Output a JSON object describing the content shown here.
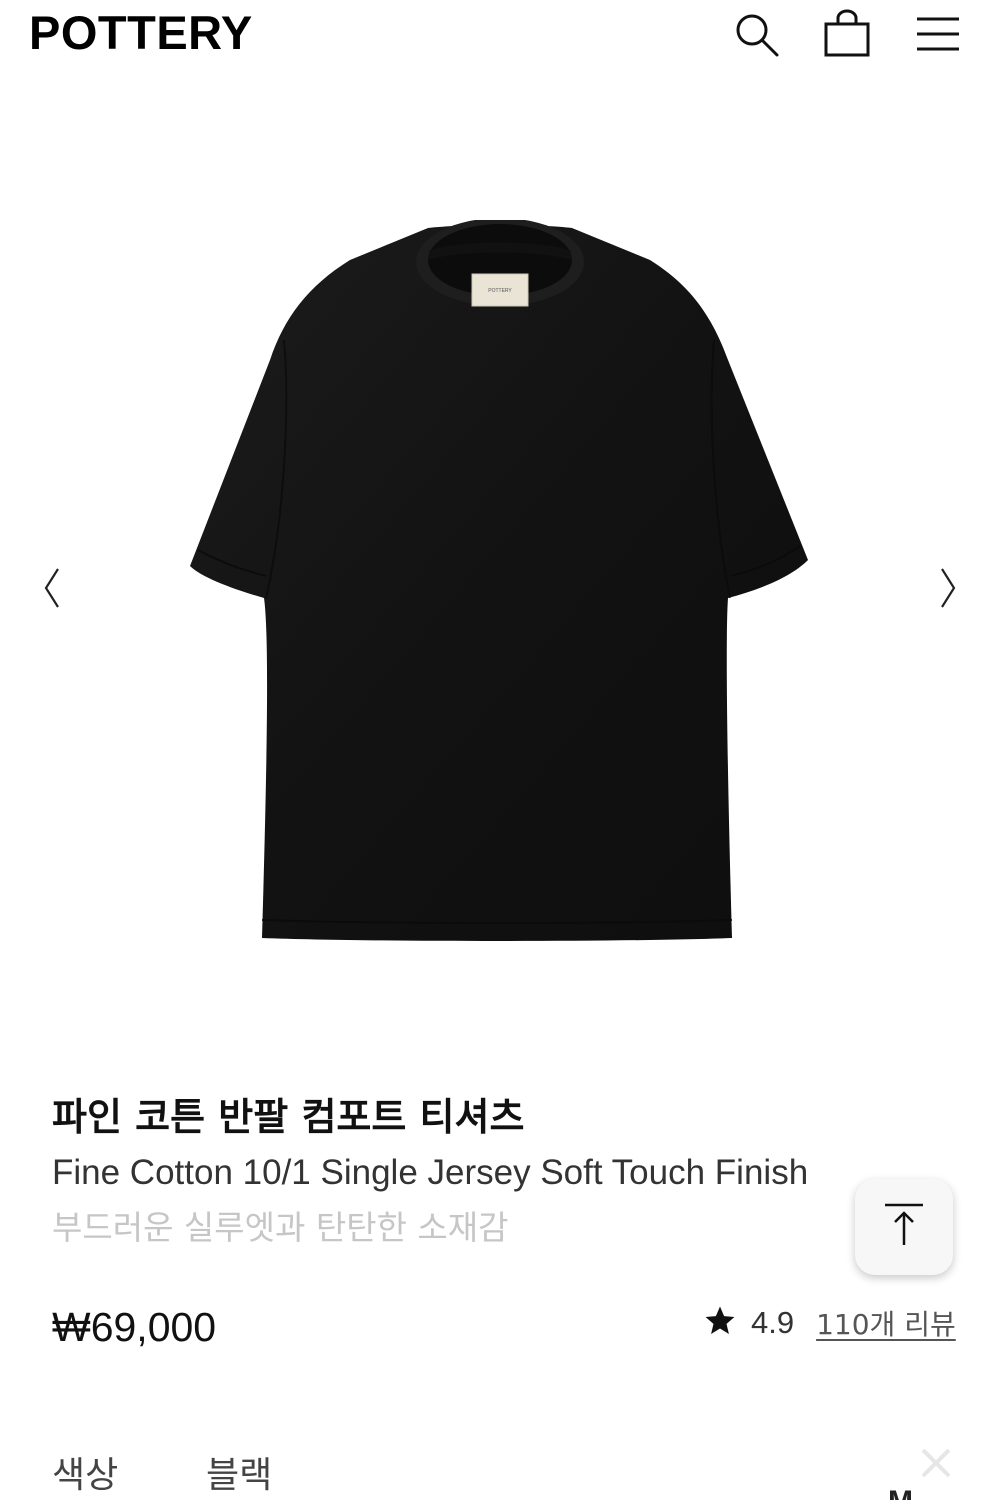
{
  "header": {
    "logo": "POTTERY",
    "icons": {
      "search": "search-icon",
      "cart": "shopping-bag-icon",
      "menu": "hamburger-menu-icon"
    }
  },
  "gallery": {
    "prev_arrow": "‹",
    "next_arrow": "›",
    "image_label_tag": "POTTERY",
    "product_color": "#141414"
  },
  "product": {
    "title_ko": "파인 코튼 반팔 컴포트 티셔츠",
    "title_en": "Fine Cotton 10/1 Single Jersey Soft Touch Finish",
    "subtitle": "부드러운 실루엣과 탄탄한 소재감",
    "price": "₩69,000",
    "rating": {
      "star": "★",
      "value": "4.9",
      "review_link": "110개 리뷰"
    }
  },
  "scroll_to_top": {
    "icon": "arrow-up-to-top-icon"
  },
  "options": {
    "color_label": "색상",
    "color_value": "블랙",
    "close_icon": "close-icon",
    "partial_text": "M"
  },
  "colors": {
    "text_primary": "#111111",
    "text_secondary": "#333333",
    "text_muted": "#c6c6c6",
    "background": "#ffffff"
  }
}
